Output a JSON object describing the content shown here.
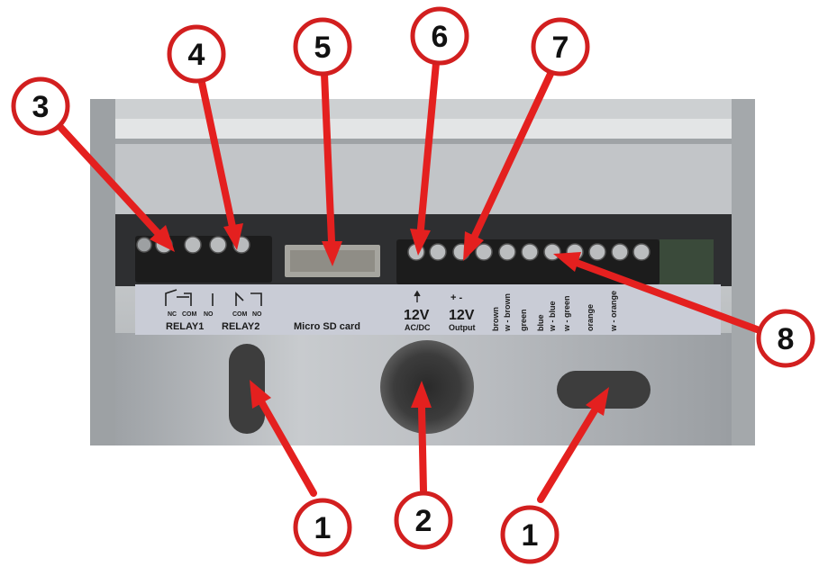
{
  "panel": {
    "relay1": {
      "contacts": [
        "NC",
        "COM",
        "NO"
      ],
      "label": "RELAY1"
    },
    "relay2": {
      "contacts": [
        "COM",
        "NO"
      ],
      "label": "RELAY2"
    },
    "sd_label": "Micro SD card",
    "power_in": {
      "voltage": "12V",
      "type": "AC/DC"
    },
    "power_out": {
      "polarity": "+ -",
      "voltage": "12V",
      "type": "Output"
    },
    "wires": [
      "brown",
      "w - brown",
      "green",
      "blue",
      "w - blue",
      "w - green",
      "orange",
      "w - orange"
    ]
  },
  "callouts": [
    {
      "id": "c1a",
      "number": "1"
    },
    {
      "id": "c1b",
      "number": "1"
    },
    {
      "id": "c2",
      "number": "2"
    },
    {
      "id": "c3",
      "number": "3"
    },
    {
      "id": "c4",
      "number": "4"
    },
    {
      "id": "c5",
      "number": "5"
    },
    {
      "id": "c6",
      "number": "6"
    },
    {
      "id": "c7",
      "number": "7"
    },
    {
      "id": "c8",
      "number": "8"
    }
  ],
  "colors": {
    "callout_ring": "#d21f1f",
    "arrow": "#e4201f",
    "panel": "#c9ccd6",
    "housing": "#b8bcbf",
    "terminal_block": "#1c1c1c"
  }
}
